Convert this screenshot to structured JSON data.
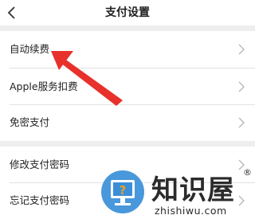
{
  "header": {
    "title": "支付设置",
    "back_icon": "chevron-left-icon"
  },
  "groups": [
    {
      "items": [
        {
          "label": "自动续费",
          "icon": "chevron-right-icon"
        },
        {
          "label": "Apple服务扣费",
          "icon": "chevron-right-icon"
        },
        {
          "label": "免密支付",
          "icon": "chevron-right-icon"
        }
      ]
    },
    {
      "items": [
        {
          "label": "修改支付密码",
          "icon": "chevron-right-icon"
        },
        {
          "label": "忘记支付密码",
          "icon": "chevron-right-icon"
        }
      ]
    }
  ],
  "annotation": {
    "arrow_color": "#e8312b",
    "arrow_target": "自动续费"
  },
  "watermark": {
    "brand": "知识屋",
    "registered_mark": "®",
    "domain": "zhishiwu.com",
    "logo_colors": {
      "ring": "#3a8fd8",
      "inner": "#ffffff",
      "question": "#f0a020"
    }
  },
  "colors": {
    "page_background": "#eeeeee",
    "card_background": "#ffffff",
    "chevron": "#b5b5b5",
    "text": "#222222"
  }
}
